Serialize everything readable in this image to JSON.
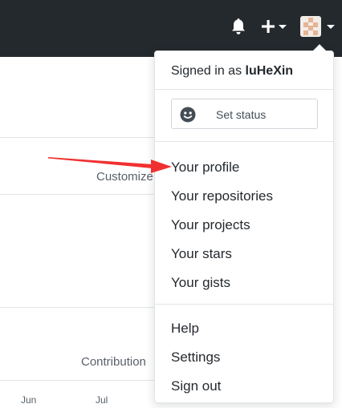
{
  "header": {
    "notifications_icon": "bell-icon",
    "create_icon": "plus-icon",
    "avatar_icon": "user-avatar",
    "colors": {
      "background": "#24292e",
      "icon": "#ffffff"
    }
  },
  "background": {
    "customize_label": "Customize",
    "contribution_label": "Contribution",
    "months": [
      "Jun",
      "Jul"
    ]
  },
  "dropdown": {
    "signed_in_prefix": "Signed in as",
    "username": "luHeXin",
    "set_status_label": "Set status",
    "set_status_icon": "smiley-icon",
    "profile_items": [
      "Your profile",
      "Your repositories",
      "Your projects",
      "Your stars",
      "Your gists"
    ],
    "account_items": [
      "Help",
      "Settings",
      "Sign out"
    ]
  },
  "annotation": {
    "arrow_color": "#f03030"
  }
}
